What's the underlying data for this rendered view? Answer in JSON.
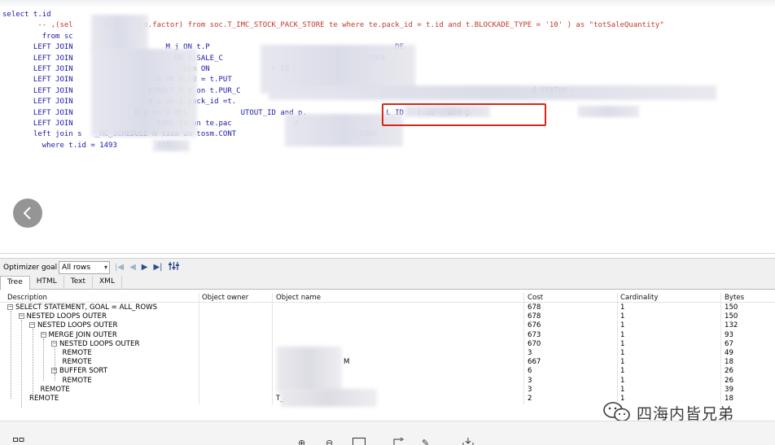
{
  "editor": {
    "lines": [
      {
        "text": "select t.id",
        "cls": "kw"
      },
      {
        "text": "        -- ,(sel       t.c     te.factor) from soc.T_IMC_STOCK_PACK_STORE te where te.pack_id = t.id and t.BLOCKADE_TYPE = '10' ) as \"totSaleQuantity\"",
        "cls": "cmt"
      },
      {
        "text": "         from sc",
        "cls": "kw"
      },
      {
        "text": "       LEFT JOIN                     M j ON t.P                                          DE",
        "cls": "kw"
      },
      {
        "text": "       LEFT JOIN                       ON t.SALE_C                                _CODE",
        "cls": "kw"
      },
      {
        "text": "       LEFT JOIN                         spm ON              t.ID",
        "cls": "kw"
      },
      {
        "text": "       LEFT JOIN                   m ON m.id = t.PUT",
        "cls": "kw"
      },
      {
        "text": "       LEFT JOIN                 NTRACT_D d on t.PUR_C                                                                  d.STATUS >",
        "cls": "kw"
      },
      {
        "text": "       LEFT JOIN                 d o on o.pack_id =t.",
        "cls": "kw"
      },
      {
        "text": "       LEFT JOIN              D p on p.REL            UTOUT_ID and p.                  L_ID = t.id   and p",
        "cls": "kw"
      },
      {
        "text": "       LEFT JOIN                   TORE te on te.pac              d",
        "cls": "kw"
      },
      {
        "text": "       left join s   _MC_SCHEDULE M tosm on tosm.CONT                           _CODE",
        "cls": "kw"
      },
      {
        "text": "         where t.id = 1493         431",
        "cls": "kw"
      }
    ]
  },
  "optimizer": {
    "label": "Optimizer goal",
    "select_value": "All rows"
  },
  "tabs": [
    {
      "label": "Tree",
      "active": true
    },
    {
      "label": "HTML",
      "active": false
    },
    {
      "label": "Text",
      "active": false
    },
    {
      "label": "XML",
      "active": false
    }
  ],
  "grid": {
    "columns": [
      "Description",
      "Object owner",
      "Object name",
      "Cost",
      "Cardinality",
      "Bytes"
    ],
    "rows": [
      {
        "desc": "SELECT STATEMENT, GOAL = ALL_ROWS",
        "depth": 0,
        "toggle": "-",
        "name": "",
        "cost": "678",
        "card": "1",
        "bytes": "150"
      },
      {
        "desc": "NESTED LOOPS OUTER",
        "depth": 1,
        "toggle": "-",
        "name": "",
        "cost": "678",
        "card": "1",
        "bytes": "150"
      },
      {
        "desc": "NESTED LOOPS OUTER",
        "depth": 2,
        "toggle": "-",
        "name": "",
        "cost": "676",
        "card": "1",
        "bytes": "132"
      },
      {
        "desc": "MERGE JOIN OUTER",
        "depth": 3,
        "toggle": "-",
        "name": "",
        "cost": "673",
        "card": "1",
        "bytes": "93"
      },
      {
        "desc": "NESTED LOOPS OUTER",
        "depth": 4,
        "toggle": "-",
        "name": "",
        "cost": "670",
        "card": "1",
        "bytes": "67"
      },
      {
        "desc": "REMOTE",
        "depth": 5,
        "toggle": "",
        "name": "",
        "cost": "3",
        "card": "1",
        "bytes": "49"
      },
      {
        "desc": "REMOTE",
        "depth": 5,
        "toggle": "",
        "name": "M",
        "cost": "667",
        "card": "1",
        "bytes": "18"
      },
      {
        "desc": "BUFFER SORT",
        "depth": 4,
        "toggle": "-",
        "name": "",
        "cost": "6",
        "card": "1",
        "bytes": "26"
      },
      {
        "desc": "REMOTE",
        "depth": 5,
        "toggle": "",
        "name": "",
        "cost": "3",
        "card": "1",
        "bytes": "26"
      },
      {
        "desc": "REMOTE",
        "depth": 3,
        "toggle": "",
        "name": "",
        "cost": "3",
        "card": "1",
        "bytes": "39"
      },
      {
        "desc": "REMOTE",
        "depth": 2,
        "toggle": "",
        "name": "T_C",
        "cost": "2",
        "card": "1",
        "bytes": "18"
      }
    ]
  },
  "watermark": {
    "text": "四海内皆兄弟"
  },
  "colors": {
    "keyword": "#1a1aa6",
    "comment": "#c0392b",
    "highlight_box": "#d9261c"
  }
}
